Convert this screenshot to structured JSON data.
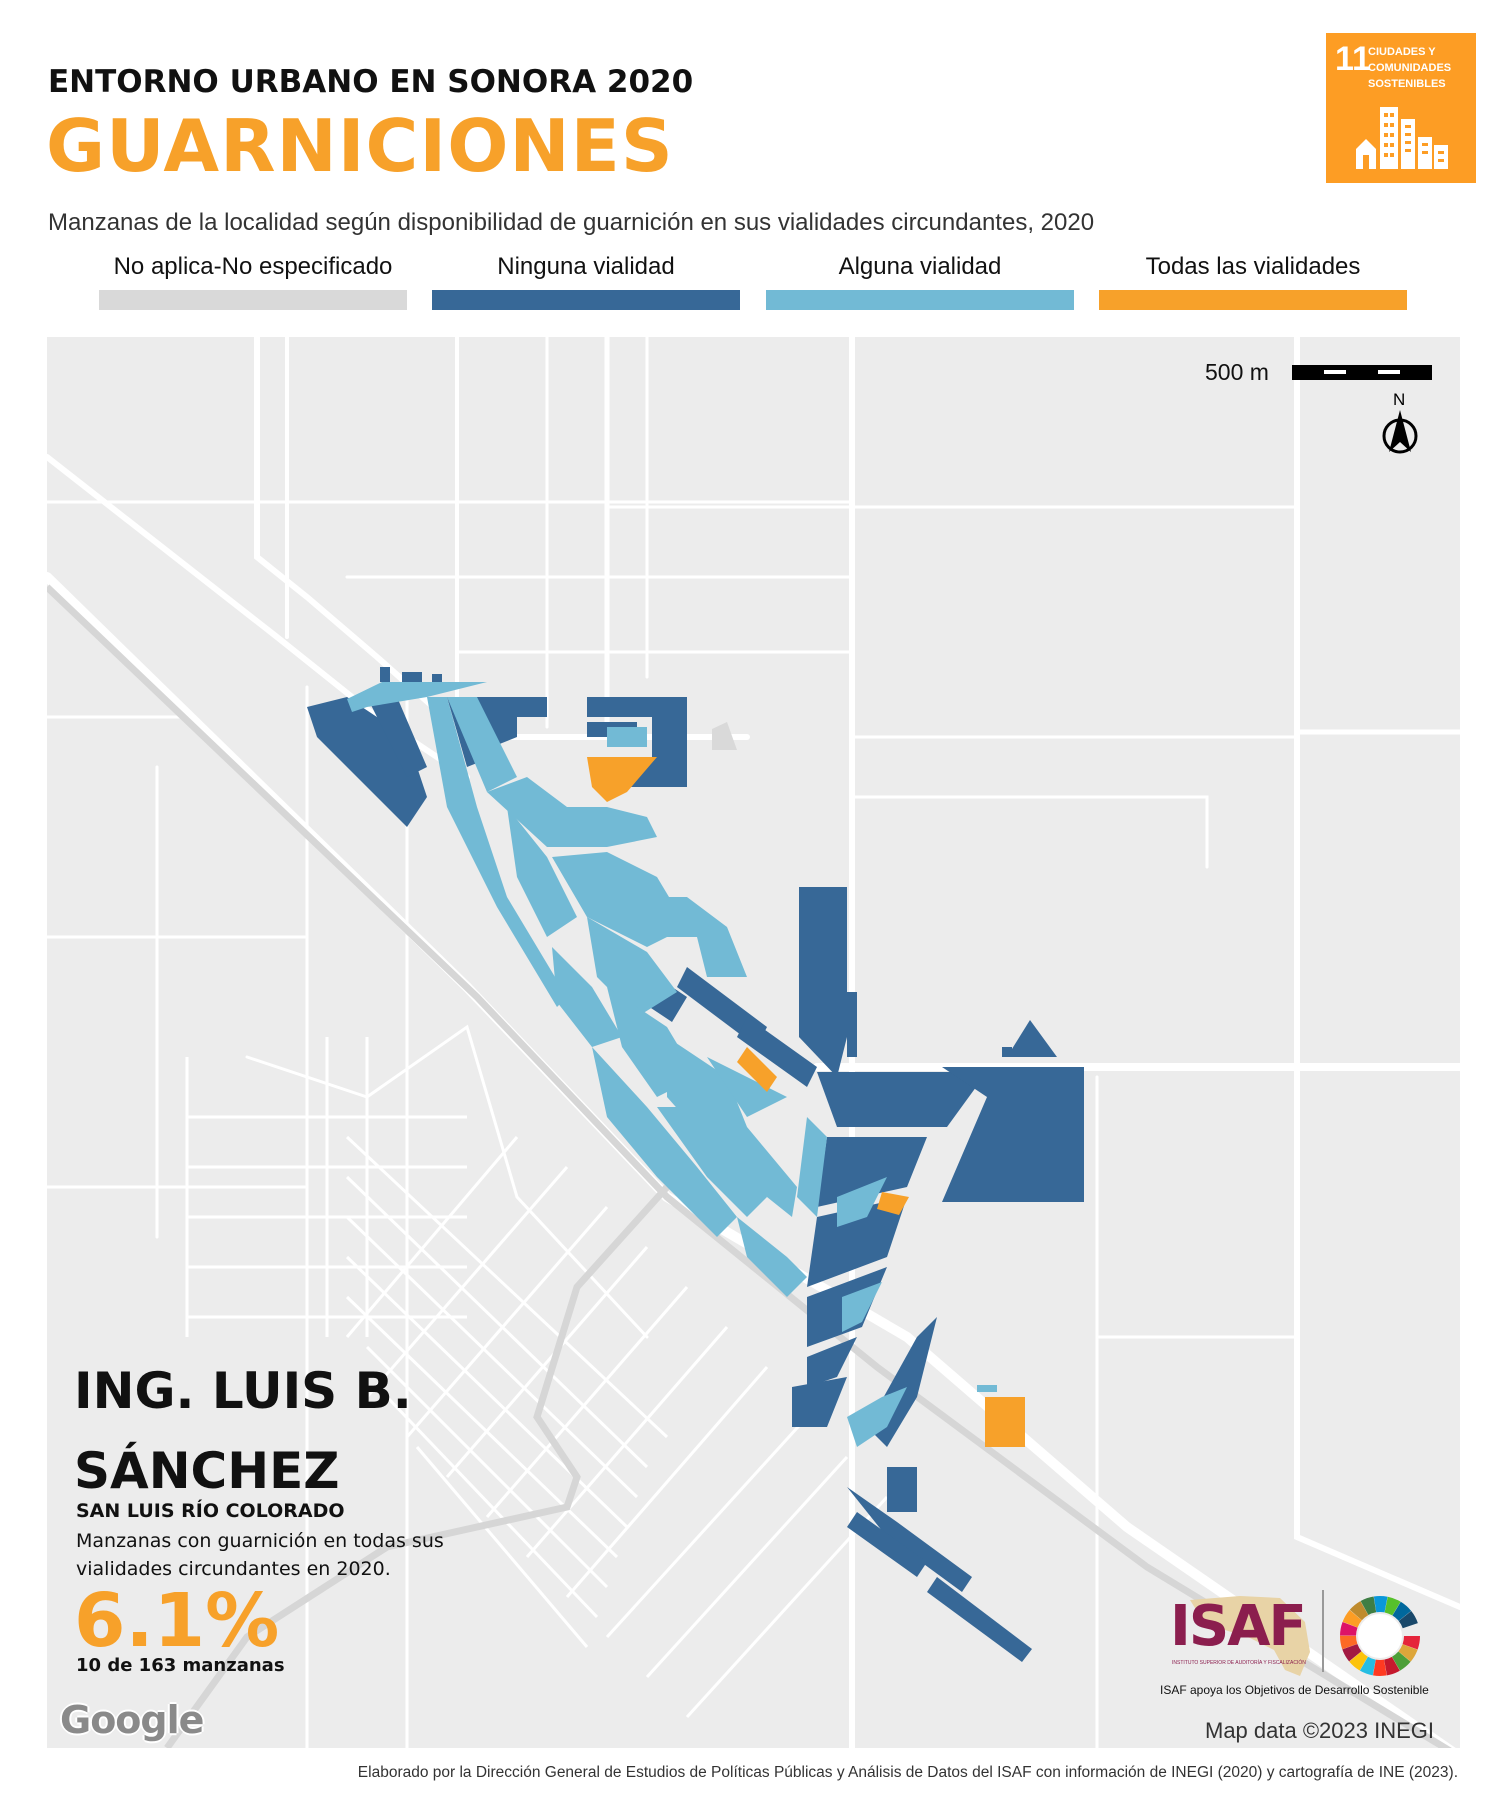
{
  "header": {
    "supertitle": "ENTORNO URBANO EN SONORA 2020",
    "title": "GUARNICIONES",
    "subtitle": "Manzanas de la localidad según disponibilidad de guarnición en sus vialidades circundantes, 2020"
  },
  "sdg_badge": {
    "number": "11",
    "label": "CIUDADES Y COMUNIDADES SOSTENIBLES",
    "color": "#FD9D24",
    "icon": "city-buildings-icon"
  },
  "legend": [
    {
      "label": "No aplica-No especificado",
      "color": "#D9D9D9"
    },
    {
      "label": "Ninguna vialidad",
      "color": "#376897"
    },
    {
      "label": "Alguna vialidad",
      "color": "#72BAD5"
    },
    {
      "label": "Todas las vialidades",
      "color": "#F7A12A"
    }
  ],
  "map": {
    "scale_label": "500 m",
    "north_label": "N",
    "attribution": "Map data ©2023 INEGI",
    "provider": "Google",
    "background_color": "#ECECEC",
    "road_color": "#FFFFFF",
    "railway_color": "#D6D6D6"
  },
  "locality": {
    "name_line1": "ING. LUIS B.",
    "name_line2": "SÁNCHEZ",
    "municipality": "SAN LUIS RÍO COLORADO",
    "description": "Manzanas con guarnición en todas sus vialidades circundantes en 2020.",
    "percentage": "6.1%",
    "count_text": "10 de 163 manzanas"
  },
  "logos": {
    "isaf": "ISAF",
    "isaf_fine_print": "INSTITUTO SUPERIOR DE AUDITORÍA Y FISCALIZACIÓN",
    "caption": "ISAF apoya los Objetivos de Desarrollo Sostenible"
  },
  "footer": "Elaborado por la Dirección General de Estudios de Políticas Públicas y Análisis de Datos del ISAF con información de INEGI (2020) y cartografía de INE (2023)."
}
